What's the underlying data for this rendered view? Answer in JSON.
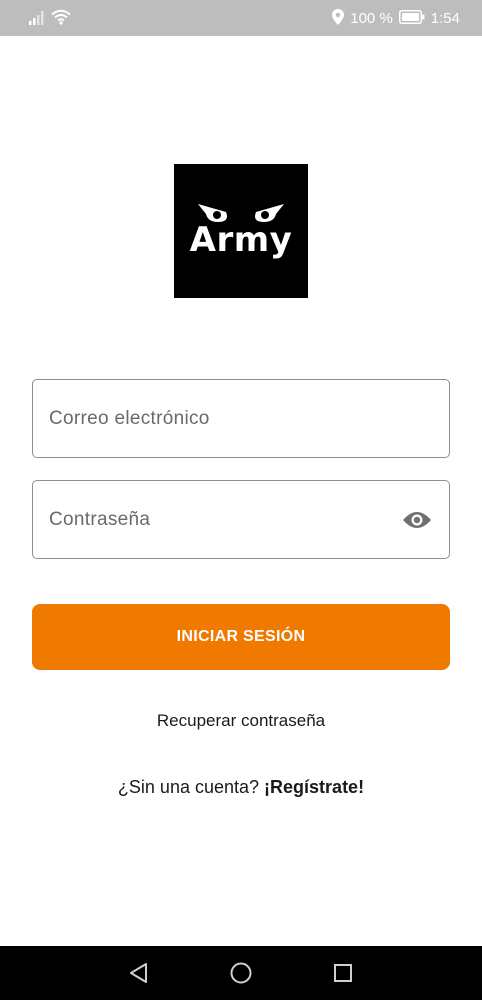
{
  "status_bar": {
    "battery_percent": "100 %",
    "time": "1:54",
    "icons": [
      "signal-icon",
      "wifi-icon",
      "location-icon",
      "battery-icon"
    ]
  },
  "logo": {
    "text": "Army",
    "icon": "owl-eyes-icon"
  },
  "login_form": {
    "email_placeholder": "Correo electrónico",
    "email_value": "",
    "password_placeholder": "Contraseña",
    "password_value": "",
    "password_toggle_icon": "eye-icon",
    "submit_label": "INICIAR SESIÓN"
  },
  "links": {
    "recover_password": "Recuperar contraseña",
    "signup_prompt": "¿Sin una cuenta?",
    "signup_link": "¡Regístrate!"
  },
  "nav_bar": {
    "icons": [
      "back-icon",
      "home-icon",
      "recent-apps-icon"
    ]
  },
  "colors": {
    "accent": "#f07900",
    "status_bar": "#bdbdbd",
    "field_border": "#8e8e8e",
    "nav_bar": "#000000"
  }
}
